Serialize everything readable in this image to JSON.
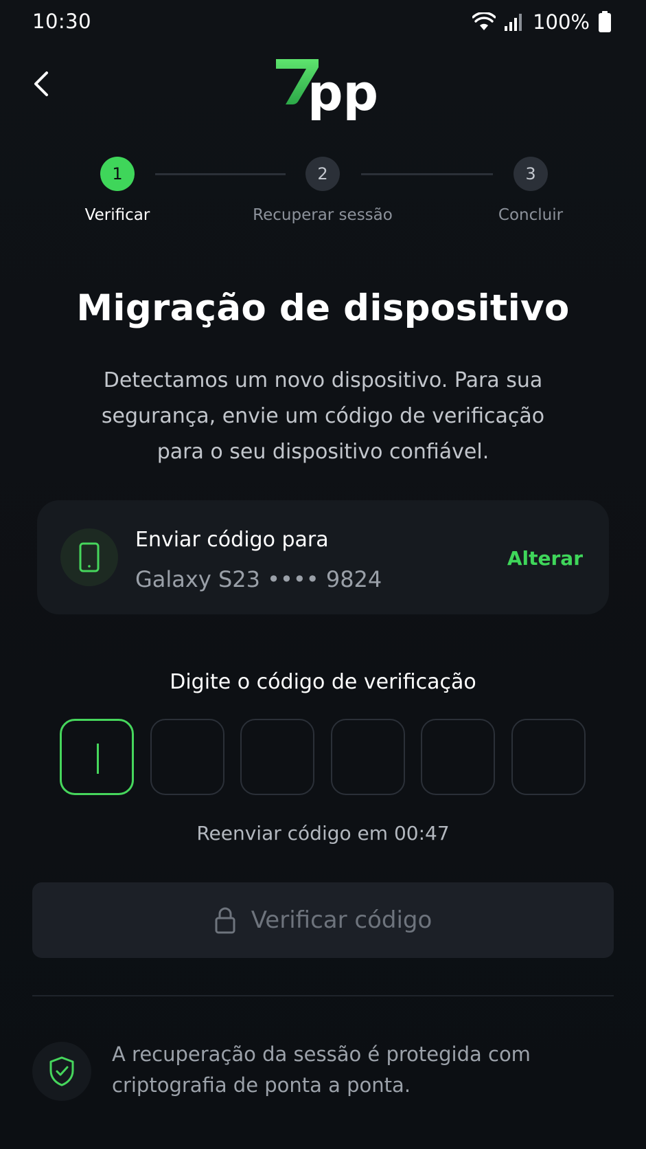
{
  "status_bar": {
    "time": "10:30",
    "battery_percent": "100%",
    "icons": [
      "wifi-icon",
      "signal-icon",
      "battery-icon"
    ]
  },
  "header": {
    "back_icon": "chevron-left-icon",
    "logo": {
      "accent_text": "7",
      "text": "pp",
      "accent_color": "#3fd65a"
    }
  },
  "stepper": {
    "steps": [
      {
        "number": "1",
        "label": "Verificar",
        "state": "active"
      },
      {
        "number": "2",
        "label": "Recuperar sessão",
        "state": "inactive"
      },
      {
        "number": "3",
        "label": "Concluir",
        "state": "inactive"
      }
    ]
  },
  "main": {
    "title": "Migração de dispositivo",
    "description": "Detectamos um novo dispositivo. Para sua segurança, envie um código de verificação para o seu dispositivo confiável."
  },
  "device_card": {
    "icon": "smartphone-icon",
    "title": "Enviar código para",
    "device": "Galaxy S23 •••• 9824",
    "change_label": "Alterar"
  },
  "code_entry": {
    "label": "Digite o código de verificação",
    "digits": [
      "",
      "",
      "",
      "",
      "",
      ""
    ],
    "focused_index": 0,
    "resend_text": "Reenviar código em 00:47"
  },
  "verify_button": {
    "icon": "lock-icon",
    "label": "Verificar código",
    "enabled": false
  },
  "footer": {
    "icon": "shield-check-icon",
    "note": "A recuperação da sessão é protegida com criptografia de ponta a ponta."
  },
  "colors": {
    "accent": "#3fd65a",
    "background": "#0d1014",
    "card": "#161a1f"
  }
}
